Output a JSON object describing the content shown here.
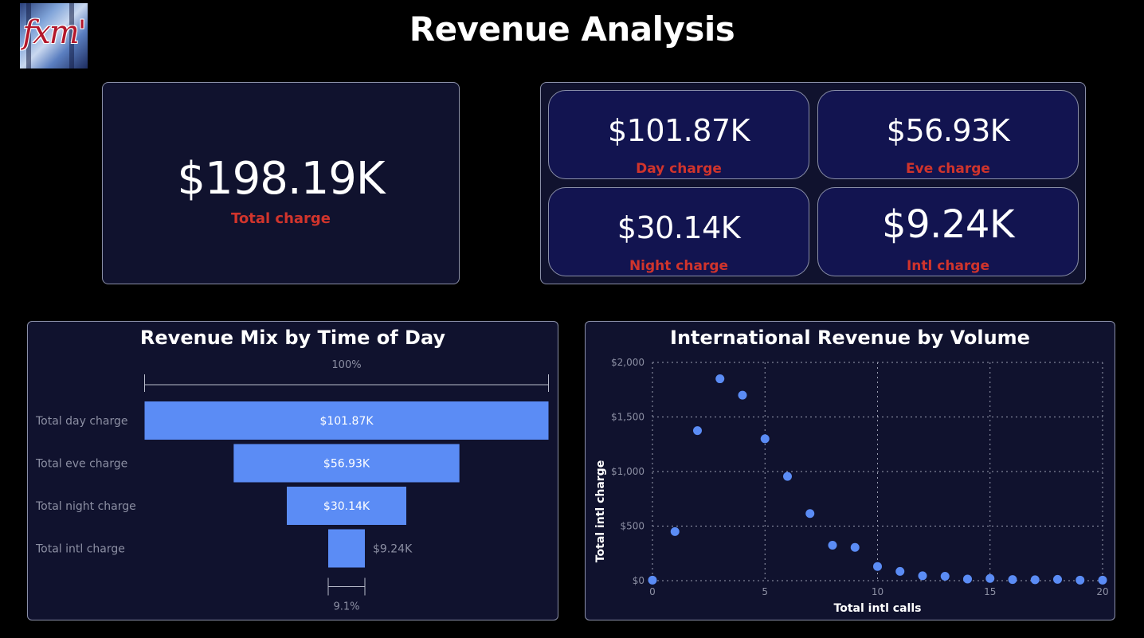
{
  "header": {
    "title": "Revenue Analysis",
    "logo_text": "fxm'"
  },
  "kpis": {
    "total": {
      "value": "$198.19K",
      "label": "Total charge"
    },
    "day": {
      "value": "$101.87K",
      "label": "Day charge"
    },
    "eve": {
      "value": "$56.93K",
      "label": "Eve charge"
    },
    "night": {
      "value": "$30.14K",
      "label": "Night charge"
    },
    "intl": {
      "value": "$9.24K",
      "label": "Intl charge"
    }
  },
  "colors": {
    "accent": "#5b8cf5",
    "label_red": "#d0342c",
    "card_bg": "#10122e",
    "mini_bg": "#121450"
  },
  "chart_data": [
    {
      "type": "bar",
      "subtype": "funnel",
      "title": "Revenue Mix by Time of Day",
      "categories": [
        "Total day charge",
        "Total eve charge",
        "Total night charge",
        "Total intl charge"
      ],
      "values": [
        101.87,
        56.93,
        30.14,
        9.24
      ],
      "value_labels": [
        "$101.87K",
        "$56.93K",
        "$30.14K",
        "$9.24K"
      ],
      "top_percent_label": "100%",
      "bottom_percent_label": "9.1%"
    },
    {
      "type": "scatter",
      "title": "International Revenue by Volume",
      "xlabel": "Total intl calls",
      "ylabel": "Total intl charge",
      "xlim": [
        0,
        20
      ],
      "ylim": [
        0,
        2000
      ],
      "xticks": [
        0,
        5,
        10,
        15,
        20
      ],
      "yticks": [
        0,
        500,
        1000,
        1500,
        2000
      ],
      "ytick_labels": [
        "$0",
        "$500",
        "$1,000",
        "$1,500",
        "$2,000"
      ],
      "grid": true,
      "x": [
        0,
        1,
        2,
        3,
        4,
        5,
        6,
        7,
        8,
        9,
        10,
        11,
        12,
        13,
        14,
        15,
        16,
        17,
        18,
        19,
        20
      ],
      "y": [
        5,
        450,
        1375,
        1850,
        1700,
        1300,
        955,
        615,
        325,
        305,
        130,
        85,
        45,
        40,
        15,
        20,
        10,
        8,
        12,
        5,
        5
      ]
    }
  ]
}
